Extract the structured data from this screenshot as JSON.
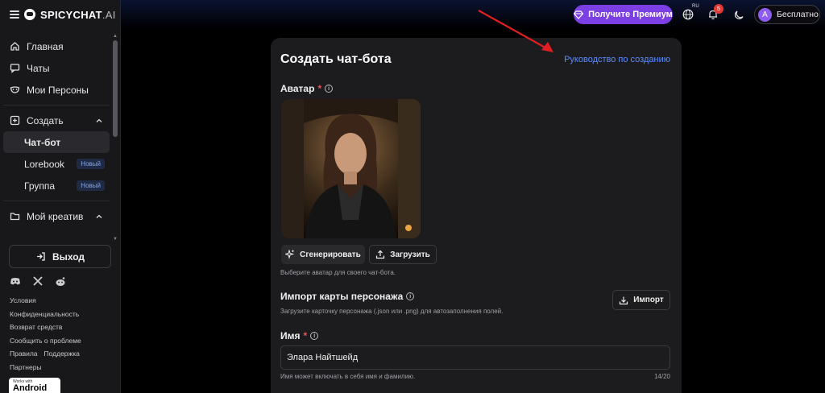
{
  "brand": {
    "name": "SPICYCHAT",
    "suffix": ".AI"
  },
  "sidebar": {
    "items": [
      {
        "label": "Главная",
        "icon": "home-icon"
      },
      {
        "label": "Чаты",
        "icon": "chat-icon"
      },
      {
        "label": "Мои Персоны",
        "icon": "mask-icon"
      }
    ],
    "create_group": {
      "label": "Создать",
      "icon": "plus-square-icon"
    },
    "create_items": [
      {
        "label": "Чат-бот",
        "badge": ""
      },
      {
        "label": "Lorebook",
        "badge": "Новый"
      },
      {
        "label": "Группа",
        "badge": "Новый"
      }
    ],
    "creative_group": {
      "label": "Мой креатив",
      "icon": "folder-icon"
    },
    "logout_label": "Выход",
    "links": [
      "Условия",
      "Конфиденциальность",
      "Возврат средств",
      "Сообщить о проблеме"
    ],
    "links_row": [
      "Правила",
      "Поддержка"
    ],
    "link_last": "Партнеры",
    "android": {
      "small": "Works with",
      "big": "Android"
    }
  },
  "topbar": {
    "premium_label": "Получите Премиум",
    "lang": "RU",
    "notifications_count": "5",
    "account_initial": "A",
    "account_label": "Бесплатно"
  },
  "form": {
    "title": "Создать чат-бота",
    "guide_link": "Руководство по созданию",
    "avatar_label": "Аватар",
    "required_mark": "*",
    "generate_label": "Сгенерировать",
    "upload_label": "Загрузить",
    "avatar_hint": "Выберите аватар для своего чат-бота.",
    "import_label": "Импорт карты персонажа",
    "import_hint": "Загрузите карточку персонажа (.json или .png) для автозаполнения полей.",
    "import_button": "Импорт",
    "name_label": "Имя",
    "name_value": "Элара Найтшейд",
    "name_hint": "Имя может включать в себя имя и фамилию.",
    "name_counter": "14/20"
  },
  "colors": {
    "accent": "#7b3fe4",
    "link": "#5b8cff",
    "annotation": "#e02020"
  }
}
